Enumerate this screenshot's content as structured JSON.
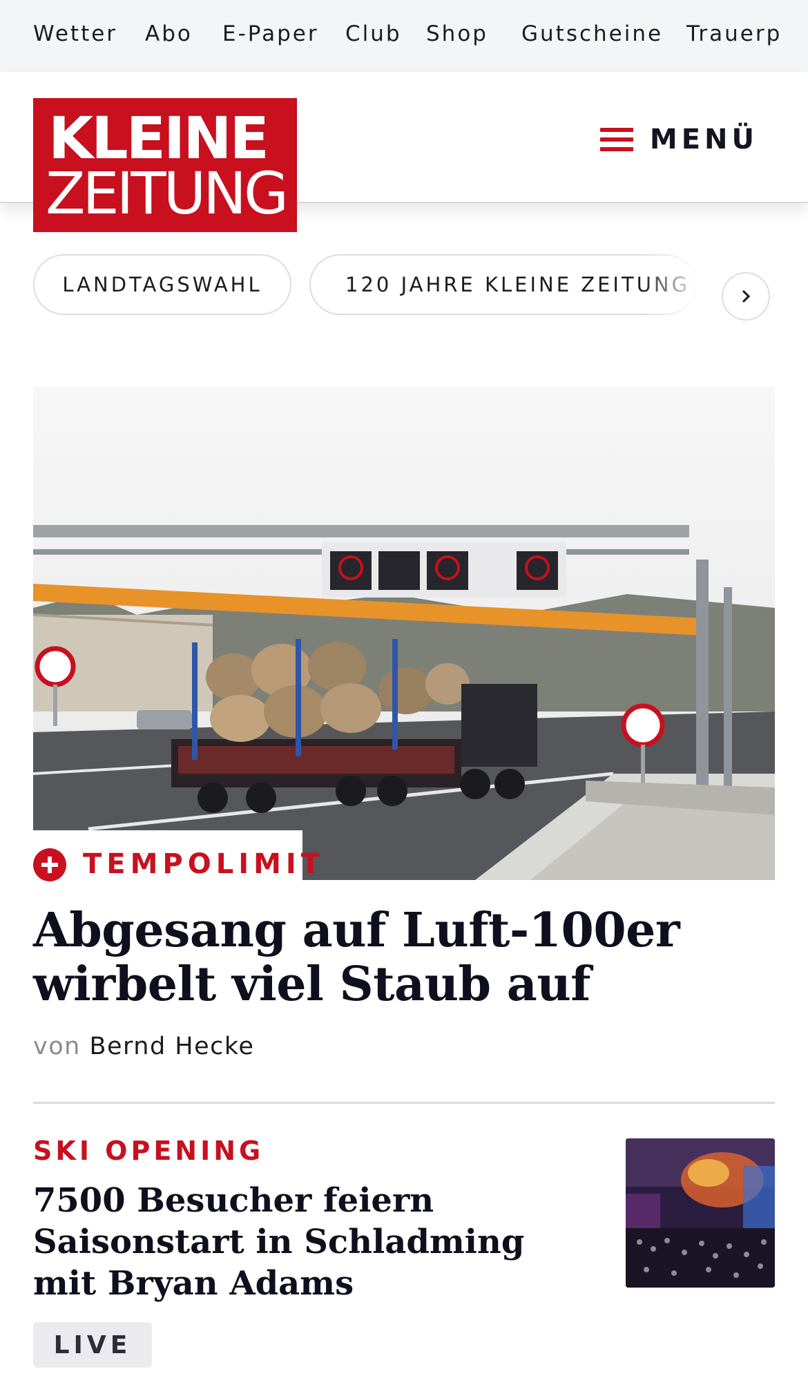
{
  "topbar": {
    "links": [
      "Wetter",
      "Abo",
      "E-Paper",
      "Club",
      "Shop",
      "Gutscheine",
      "Trauerp"
    ]
  },
  "header": {
    "logo_line1": "KLEINE",
    "logo_line2": "ZEITUNG",
    "menu_label": "MENÜ",
    "brand_color": "#c8101e"
  },
  "topics": {
    "pills": [
      "LANDTAGSWAHL",
      "120 JAHRE KLEINE ZEITUNG"
    ],
    "next_icon": "chevron-right-icon"
  },
  "hero": {
    "image_description": "Truck loaded with logs under a highway speed-limit gantry",
    "kicker": "TEMPOLIMIT",
    "kicker_icon": "plus-icon",
    "headline": "Abgesang auf Luft-100er wirbelt viel Staub auf",
    "byline_prefix": "von",
    "author": "Bernd Hecke"
  },
  "teaser": {
    "kicker": "SKI OPENING",
    "headline": "7500 Besucher feiern Saisonstart in Schladming mit Bryan Adams",
    "badge": "LIVE"
  }
}
